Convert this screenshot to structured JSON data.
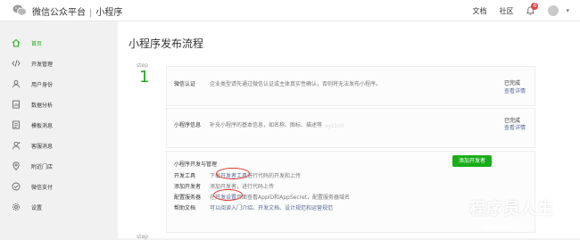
{
  "header": {
    "platform": "微信公众平台",
    "separator": "|",
    "section": "小程序",
    "links": [
      "文档",
      "社区"
    ],
    "notification_count": "6"
  },
  "sidebar": {
    "items": [
      {
        "label": "首页",
        "icon": "home-icon",
        "active": true
      },
      {
        "label": "开发管理",
        "icon": "code-icon"
      },
      {
        "label": "用户身份",
        "icon": "user-icon"
      },
      {
        "label": "数据分析",
        "icon": "chart-icon"
      },
      {
        "label": "模板消息",
        "icon": "template-icon"
      },
      {
        "label": "客服消息",
        "icon": "customer-service-icon"
      },
      {
        "label": "附近门店",
        "icon": "location-icon"
      },
      {
        "label": "微信支付",
        "icon": "payment-icon"
      },
      {
        "label": "设置",
        "icon": "settings-icon"
      }
    ]
  },
  "main": {
    "title": "小程序发布流程",
    "step1": {
      "label": "step",
      "number": "1"
    },
    "step2": {
      "label": "step"
    },
    "verify": {
      "title": "微信认证",
      "desc": "企业类型请先通过微信认证或主体真实性确认，否则将无法发布小程序。",
      "status": "已完成",
      "detail": "查看详情"
    },
    "info": {
      "title": "小程序信息",
      "desc": "补充小程序的基本信息，如名称、图标、描述等",
      "faint": "xys100",
      "status": "已完成",
      "detail": "查看详情"
    },
    "dev": {
      "title": "小程序开发与管理",
      "add_button": "添加开发者",
      "rows": [
        {
          "label": "开发工具",
          "pre": "下载",
          "link": "开发者工具",
          "post": "进行代码的开发和上传"
        },
        {
          "label": "添加开发者",
          "text": "添加开发者，进行代码上传"
        },
        {
          "label": "配置服务器",
          "pre": "在",
          "link": "开发设置",
          "post": "页面查看AppID和AppSecret，配置服务器域名"
        },
        {
          "label": "帮助文档",
          "text": "可以阅读入门介绍、开发文档、设计规范和运营规范"
        }
      ]
    }
  },
  "watermark": {
    "cn": "程序员人生",
    "url": "www.wlyu.com"
  },
  "colors": {
    "accent": "#1aad19",
    "link": "#576b95",
    "badge": "#e64340",
    "annotation": "#e0352b"
  }
}
